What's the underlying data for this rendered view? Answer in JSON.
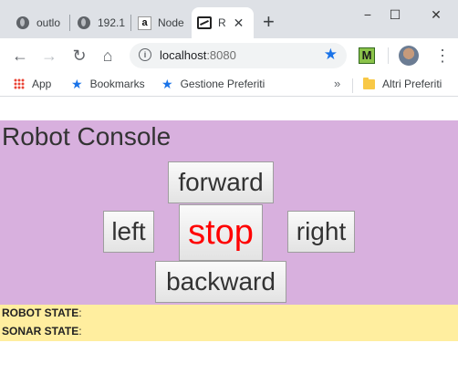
{
  "browser": {
    "tabs": [
      {
        "title": "outlo",
        "icon": "globe-icon",
        "active": false
      },
      {
        "title": "192.1",
        "icon": "globe-icon",
        "active": false
      },
      {
        "title": "Node",
        "icon": "amazon-icon",
        "active": false
      },
      {
        "title": "R",
        "icon": "robot-icon",
        "active": true
      }
    ],
    "new_tab": "+",
    "window_controls": {
      "minimize": "−",
      "maximize": "☐",
      "close": "✕"
    },
    "address": {
      "host": "localhost",
      "port": ":8080"
    },
    "extension_label": "M",
    "bookmarks": [
      {
        "label": "App",
        "icon": "apps-grid-icon"
      },
      {
        "label": "Bookmarks",
        "icon": "star-icon"
      },
      {
        "label": "Gestione Preferiti",
        "icon": "star-icon"
      }
    ],
    "bookmarks_overflow": "»",
    "other_bookmarks": "Altri Preferiti"
  },
  "console": {
    "title": "Robot Console",
    "buttons": {
      "forward": "forward",
      "left": "left",
      "stop": "stop",
      "right": "right",
      "backward": "backward"
    },
    "stop_color": "#ff0000",
    "background_color": "#d8b0de"
  },
  "status": {
    "robot_label": "ROBOT STATE",
    "robot_value": "",
    "sonar_label": "SONAR STATE",
    "sonar_value": "",
    "background_color": "#ffee9f"
  }
}
